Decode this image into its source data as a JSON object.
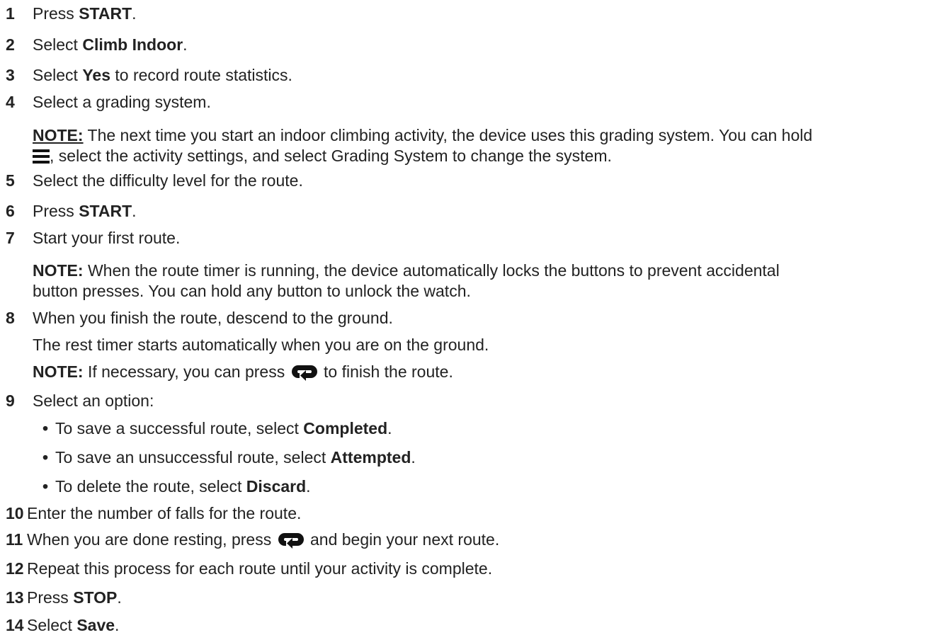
{
  "steps": {
    "s1": {
      "num": "1",
      "pre": "Press ",
      "bold": "START",
      "post": "."
    },
    "s2": {
      "num": "2",
      "pre": "Select ",
      "bold": "Climb Indoor",
      "post": "."
    },
    "s3": {
      "num": "3",
      "pre": "Select ",
      "bold": "Yes",
      "post": " to record route statistics."
    },
    "s4": {
      "num": "4",
      "text": "Select a grading system."
    },
    "note4": {
      "label": "NOTE:",
      "line1": " The next time you start an indoor climbing activity, the device uses this grading system. You can hold",
      "line2": ", select the activity settings, and select Grading System to change the system."
    },
    "s5": {
      "num": "5",
      "text": "Select the difficulty level for the route."
    },
    "s6": {
      "num": "6",
      "pre": "Press ",
      "bold": "START",
      "post": "."
    },
    "s7": {
      "num": "7",
      "text": "Start your first route."
    },
    "note7": {
      "label": "NOTE:",
      "line1": " When the route timer is running, the device automatically locks the buttons to prevent accidental",
      "line2": "button presses. You can hold any button to unlock the watch."
    },
    "s8": {
      "num": "8",
      "text": "When you finish the route, descend to the ground."
    },
    "s8b": "The rest timer starts automatically when you are on the ground.",
    "note8": {
      "label": "NOTE:",
      "pre": " If necessary, you can press ",
      "post": " to finish the route."
    },
    "s9": {
      "num": "9",
      "text": "Select an option:"
    },
    "bullets": [
      {
        "dot": "•",
        "pre": "To save a successful route, select ",
        "bold": "Completed",
        "post": "."
      },
      {
        "dot": "•",
        "pre": "To save an unsuccessful route, select ",
        "bold": "Attempted",
        "post": "."
      },
      {
        "dot": "•",
        "pre": "To delete the route, select ",
        "bold": "Discard",
        "post": "."
      }
    ],
    "s10": {
      "num": "10",
      "text": "Enter the number of falls for the route."
    },
    "s11": {
      "num": "11",
      "pre": "When you are done resting, press ",
      "post": " and begin your next route."
    },
    "s12": {
      "num": "12",
      "text": "Repeat this process for each route until your activity is complete."
    },
    "s13": {
      "num": "13",
      "pre": "Press ",
      "bold": "STOP",
      "post": "."
    },
    "s14": {
      "num": "14",
      "pre": "Select ",
      "bold": "Save",
      "post": "."
    }
  },
  "icons": {
    "menu": "menu-icon",
    "lap": "lap-icon"
  },
  "colors": {
    "text": "#222222",
    "icon": "#111111"
  }
}
